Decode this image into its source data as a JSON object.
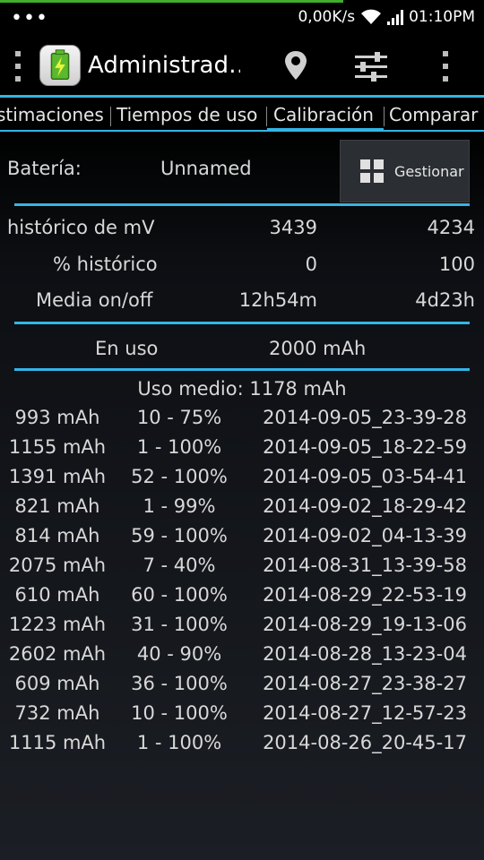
{
  "status_bar": {
    "dots": "•••",
    "net_speed": "0,00K/s",
    "time": "01:10PM",
    "progress_fraction": 0.71,
    "progress_color": "#3fae2a"
  },
  "action_bar": {
    "title": "Administrad…"
  },
  "tabs": [
    {
      "label": "stimaciones"
    },
    {
      "label": "Tiempos de uso"
    },
    {
      "label": "Calibración",
      "selected": true
    },
    {
      "label": "Comparar"
    }
  ],
  "battery": {
    "label": "Batería:",
    "name": "Unnamed",
    "manage_label": "Gestionar"
  },
  "stats": [
    {
      "label": "histórico de mV",
      "min": "3439",
      "max": "4234"
    },
    {
      "label": "% histórico",
      "min": "0",
      "max": "100"
    },
    {
      "label": "Media on/off",
      "min": "12h54m",
      "max": "4d23h"
    }
  ],
  "in_use": {
    "label": "En uso",
    "value": "2000 mAh"
  },
  "average": "Uso medio: 1178 mAh",
  "history": [
    {
      "mah": "993 mAh",
      "range": "10 - 75%",
      "date": "2014-09-05_23-39-28"
    },
    {
      "mah": "1155 mAh",
      "range": "1 - 100%",
      "date": "2014-09-05_18-22-59"
    },
    {
      "mah": "1391 mAh",
      "range": "52 - 100%",
      "date": "2014-09-05_03-54-41"
    },
    {
      "mah": "821 mAh",
      "range": "1 - 99%",
      "date": "2014-09-02_18-29-42"
    },
    {
      "mah": "814 mAh",
      "range": "59 - 100%",
      "date": "2014-09-02_04-13-39"
    },
    {
      "mah": "2075 mAh",
      "range": "7 - 40%",
      "date": "2014-08-31_13-39-58"
    },
    {
      "mah": "610 mAh",
      "range": "60 - 100%",
      "date": "2014-08-29_22-53-19"
    },
    {
      "mah": "1223 mAh",
      "range": "31 - 100%",
      "date": "2014-08-29_19-13-06"
    },
    {
      "mah": "2602 mAh",
      "range": "40 - 90%",
      "date": "2014-08-28_13-23-04"
    },
    {
      "mah": "609 mAh",
      "range": "36 - 100%",
      "date": "2014-08-27_23-38-27"
    },
    {
      "mah": "732 mAh",
      "range": "10 - 100%",
      "date": "2014-08-27_12-57-23"
    },
    {
      "mah": "1115 mAh",
      "range": "1 - 100%",
      "date": "2014-08-26_20-45-17"
    }
  ],
  "colors": {
    "accent": "#33b5e5",
    "background_top": "#000000",
    "background_bottom": "#1b1e24",
    "text": "#d8d8d8"
  }
}
